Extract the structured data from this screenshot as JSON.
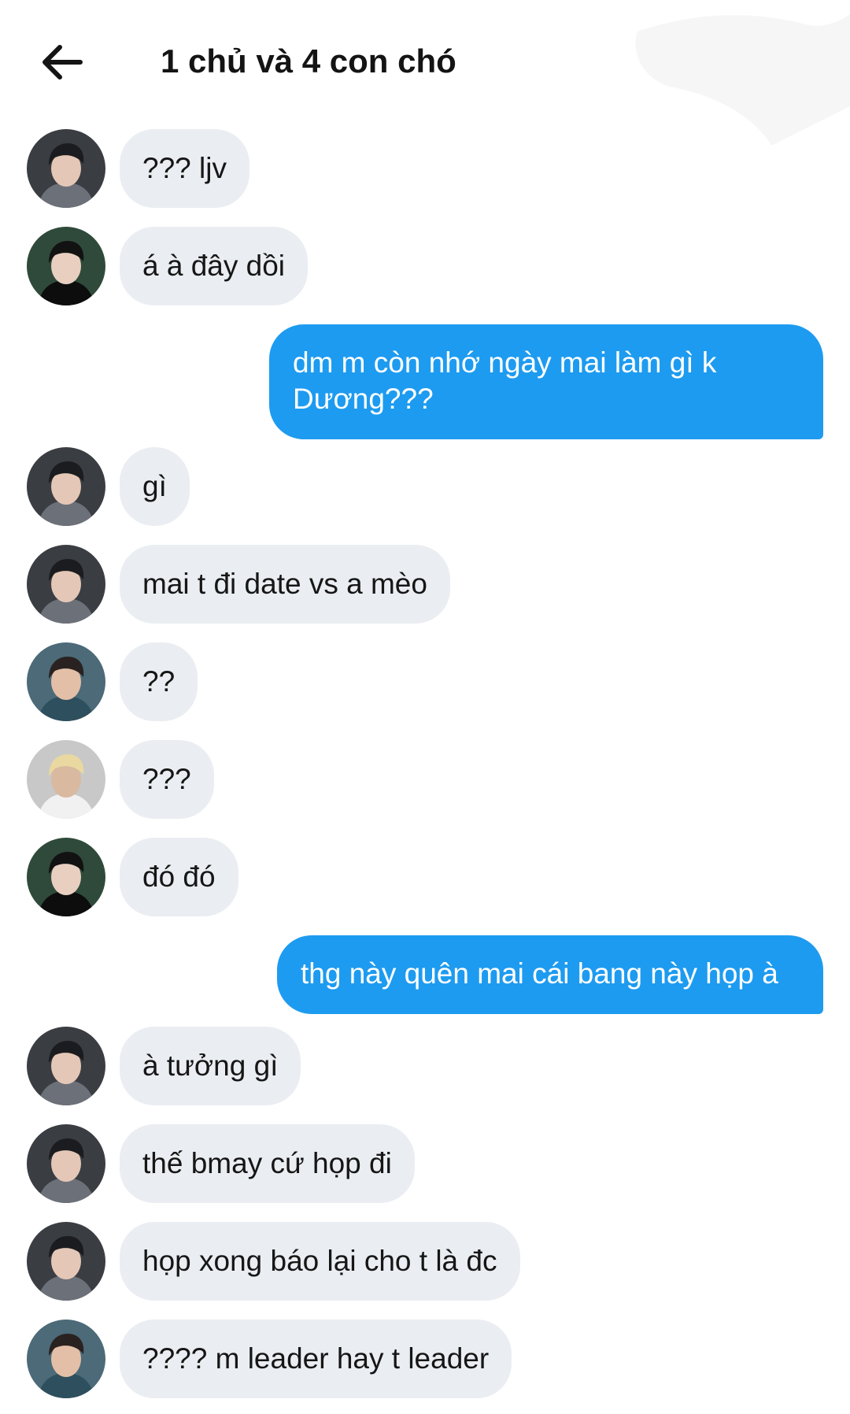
{
  "header": {
    "title": "1 chủ và 4 con chó",
    "back_icon": "arrow-left-icon"
  },
  "colors": {
    "incoming_bubble": "#eaedf1",
    "outgoing_bubble": "#1d9bf0",
    "text": "#141414"
  },
  "messages": [
    {
      "dir": "in",
      "avatar": "avatar-a",
      "text": "??? ljv"
    },
    {
      "dir": "in",
      "avatar": "avatar-b",
      "text": "á à đây dồi"
    },
    {
      "dir": "out",
      "text": "dm m còn nhớ ngày mai làm gì k Dương???"
    },
    {
      "dir": "in",
      "avatar": "avatar-a",
      "text": "gì"
    },
    {
      "dir": "in",
      "avatar": "avatar-a",
      "text": "mai t đi date vs a mèo"
    },
    {
      "dir": "in",
      "avatar": "avatar-c",
      "text": "??"
    },
    {
      "dir": "in",
      "avatar": "avatar-d",
      "text": "???"
    },
    {
      "dir": "in",
      "avatar": "avatar-b",
      "text": "đó đó"
    },
    {
      "dir": "out",
      "text": "thg này quên mai cái bang này họp à"
    },
    {
      "dir": "in",
      "avatar": "avatar-a",
      "text": "à tưởng gì"
    },
    {
      "dir": "in",
      "avatar": "avatar-a",
      "text": "thế bmay cứ họp đi"
    },
    {
      "dir": "in",
      "avatar": "avatar-a",
      "text": "họp xong báo lại cho t là đc"
    },
    {
      "dir": "in",
      "avatar": "avatar-c",
      "text": "???? m leader hay t leader"
    }
  ]
}
